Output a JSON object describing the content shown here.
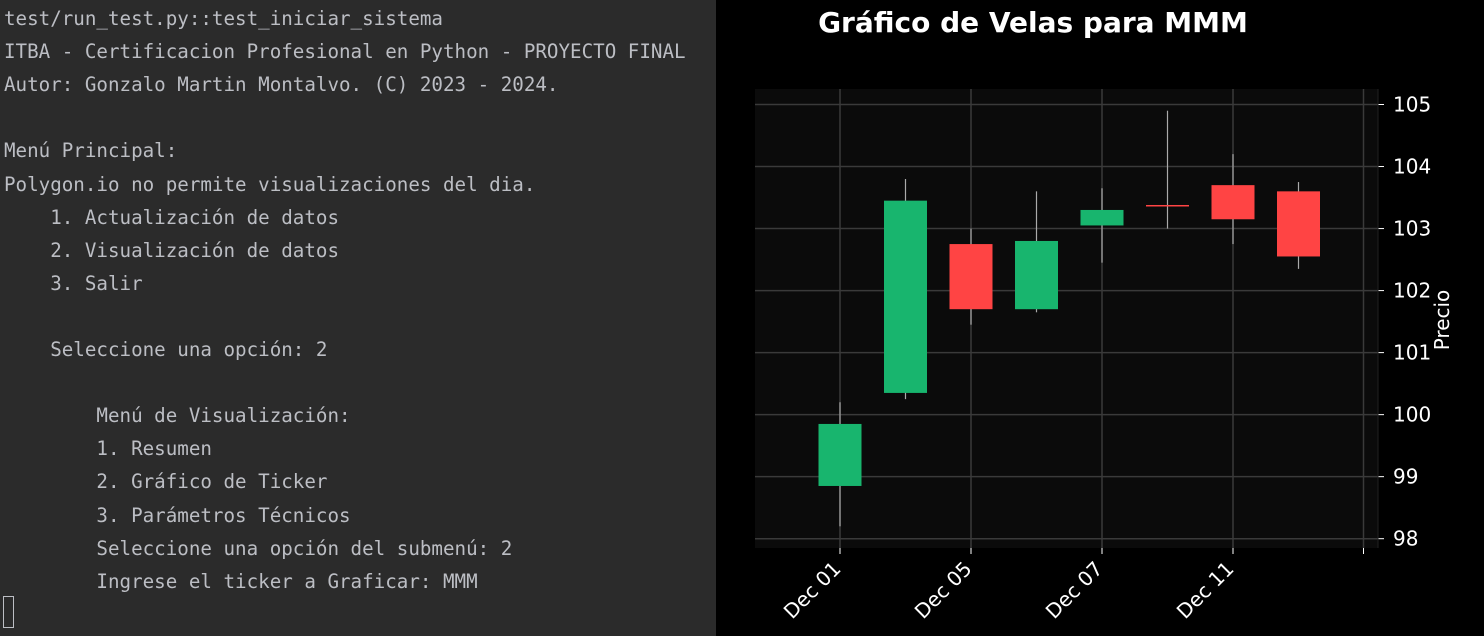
{
  "terminal": {
    "lines": [
      "test/run_test.py::test_iniciar_sistema",
      "ITBA - Certificacion Profesional en Python - PROYECTO FINAL",
      "Autor: Gonzalo Martin Montalvo. (C) 2023 - 2024.",
      "",
      "Menú Principal:",
      "Polygon.io no permite visualizaciones del dia.",
      "    1. Actualización de datos",
      "    2. Visualización de datos",
      "    3. Salir",
      "",
      "    Seleccione una opción: 2",
      "",
      "        Menú de Visualización:",
      "        1. Resumen",
      "        2. Gráfico de Ticker",
      "        3. Parámetros Técnicos",
      "        Seleccione una opción del submenú: 2",
      "        Ingrese el ticker a Graficar: MMM"
    ]
  },
  "chart_data": {
    "type": "candlestick",
    "title": "Gráfico de Velas para MMM",
    "ylabel": "Precio",
    "xlabel": "",
    "ylim": [
      97.85,
      105.25
    ],
    "yticks": [
      98,
      99,
      100,
      101,
      102,
      103,
      104,
      105
    ],
    "xtick_labels": [
      "Dec 01",
      "Dec 05",
      "Dec 07",
      "Dec 11"
    ],
    "grid": true,
    "colors": {
      "up": "#18b56e",
      "down": "#ff4444",
      "grid": "#3a3a3a",
      "plot_bg": "#0b0b0b",
      "text": "#ffffff"
    },
    "candles": [
      {
        "open": 98.85,
        "high": 100.2,
        "low": 98.2,
        "close": 99.85
      },
      {
        "open": 100.35,
        "high": 103.8,
        "low": 100.25,
        "close": 103.45
      },
      {
        "open": 102.75,
        "high": 103.0,
        "low": 101.45,
        "close": 101.7
      },
      {
        "open": 101.7,
        "high": 103.6,
        "low": 101.65,
        "close": 102.8
      },
      {
        "open": 103.05,
        "high": 103.65,
        "low": 102.45,
        "close": 103.3
      },
      {
        "open": 103.38,
        "high": 104.9,
        "low": 103.0,
        "close": 103.36
      },
      {
        "open": 103.7,
        "high": 104.2,
        "low": 102.75,
        "close": 103.15
      },
      {
        "open": 103.6,
        "high": 103.75,
        "low": 102.35,
        "close": 102.55
      }
    ]
  }
}
